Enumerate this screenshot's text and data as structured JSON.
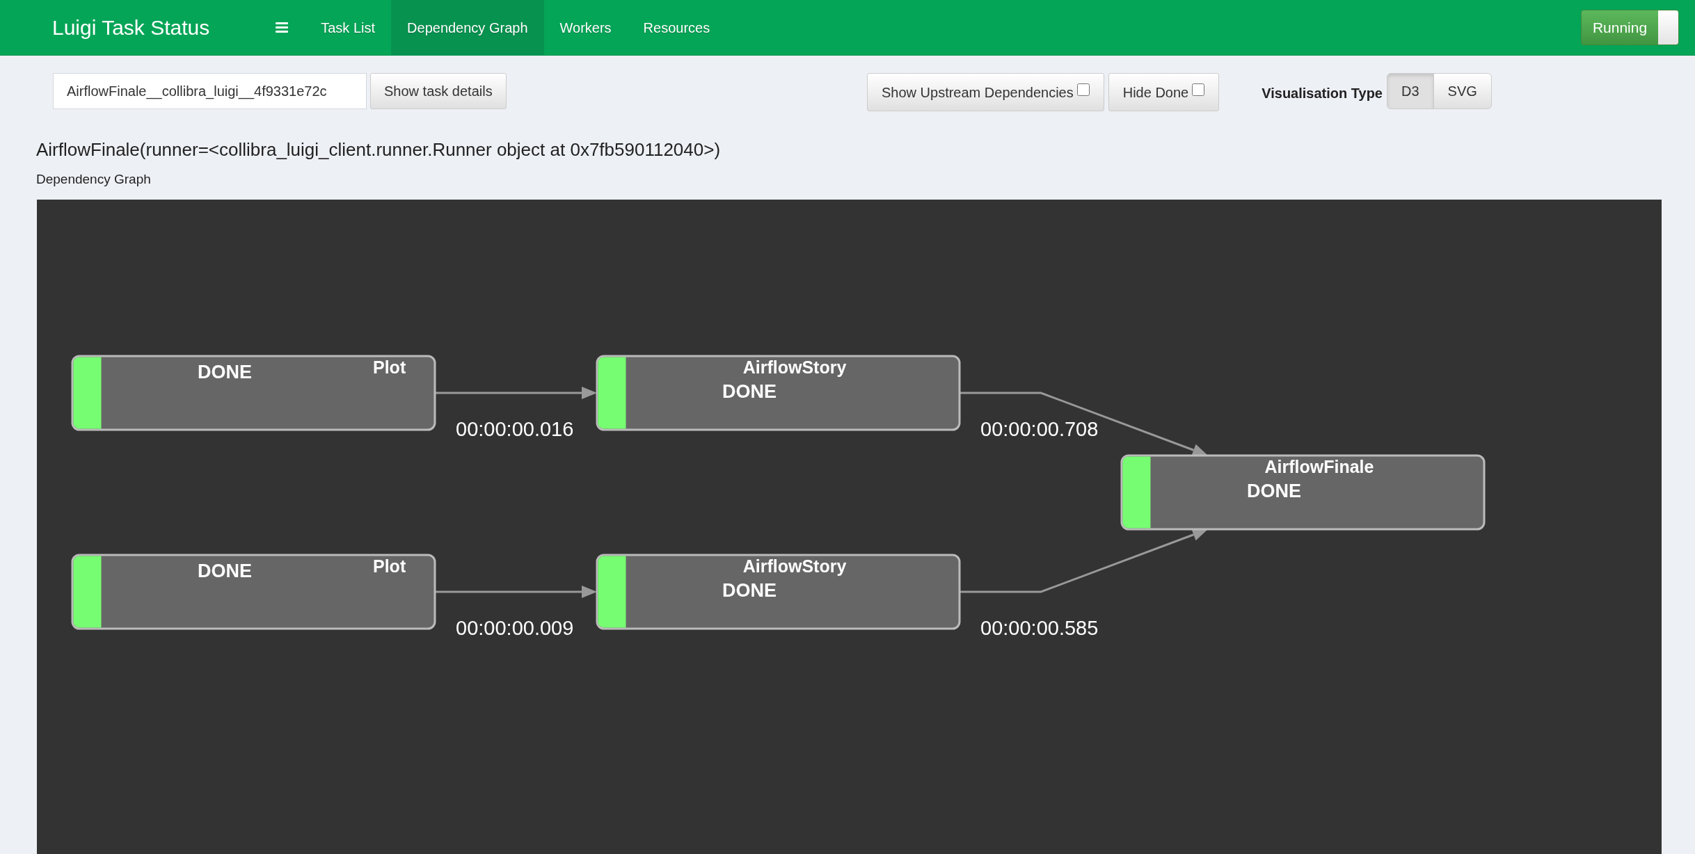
{
  "navbar": {
    "brand": "Luigi Task Status",
    "tabs": [
      {
        "label": "Task List",
        "selected": false
      },
      {
        "label": "Dependency Graph",
        "selected": true
      },
      {
        "label": "Workers",
        "selected": false
      },
      {
        "label": "Resources",
        "selected": false
      }
    ],
    "status_switch": {
      "label": "Running",
      "on": true
    }
  },
  "toolbar": {
    "task_field": {
      "value": "AirflowFinale__collibra_luigi__4f9331e72c"
    },
    "details_button": "Show task details",
    "filters": [
      {
        "label": "Show Upstream Dependencies",
        "checked": false
      },
      {
        "label": "Hide Done",
        "checked": false
      }
    ],
    "visualisation": {
      "label": "Visualisation Type",
      "options": [
        {
          "label": "D3",
          "selected": true
        },
        {
          "label": "SVG",
          "selected": false
        }
      ]
    }
  },
  "task_title": "AirflowFinale(runner=<collibra_luigi_client.runner.Runner object at 0x7fb590112040>)",
  "graph": {
    "caption": "Dependency Graph",
    "tasks": [
      {
        "name": "AirflowFinale",
        "status": "DONE",
        "color": "#77fd72",
        "children": [
          {
            "name": "AirflowStory",
            "status": "DONE",
            "color": "#77fd72",
            "duration": "00:00:00.708",
            "children": [
              {
                "name": "Plot",
                "status": "DONE",
                "color": "#77fd72",
                "duration": "00:00:00.016"
              }
            ]
          },
          {
            "name": "AirflowStory",
            "status": "DONE",
            "color": "#77fd72",
            "duration": "00:00:00.585",
            "children": [
              {
                "name": "Plot",
                "status": "DONE",
                "color": "#77fd72",
                "duration": "00:00:00.009"
              }
            ]
          }
        ]
      }
    ]
  }
}
